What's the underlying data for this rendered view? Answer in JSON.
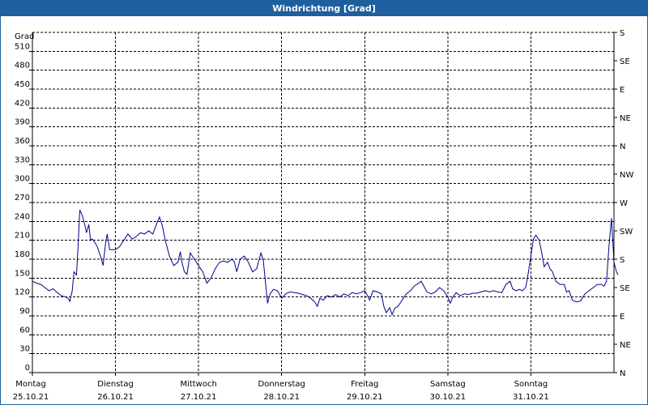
{
  "window": {
    "title": "Windrichtung [Grad]"
  },
  "chart_data": {
    "type": "line",
    "title": "Windrichtung [Grad]",
    "ylabel": "Grad",
    "ylim": [
      0,
      540
    ],
    "y_ticks": [
      0,
      30,
      60,
      90,
      120,
      150,
      180,
      210,
      240,
      270,
      300,
      330,
      360,
      390,
      420,
      450,
      480,
      510
    ],
    "y2_labels": [
      {
        "value": 0,
        "label": "N"
      },
      {
        "value": 30,
        "label": "NE"
      },
      {
        "value": 60,
        "label": "E"
      },
      {
        "value": 90,
        "label": "SE"
      },
      {
        "value": 120,
        "label": "S"
      },
      {
        "value": 150,
        "label": "SW"
      },
      {
        "value": 180,
        "label": "W"
      },
      {
        "value": 210,
        "label": "NW"
      },
      {
        "value": 240,
        "label": "N"
      },
      {
        "value": 270,
        "label": "NE"
      },
      {
        "value": 300,
        "label": "E"
      },
      {
        "value": 330,
        "label": "SE"
      },
      {
        "value": 360,
        "label": "S"
      }
    ],
    "xlim": [
      0,
      7
    ],
    "x_ticks": [
      {
        "day": "Montag",
        "date": "25.10.21",
        "x": 0
      },
      {
        "day": "Dienstag",
        "date": "26.10.21",
        "x": 1
      },
      {
        "day": "Mittwoch",
        "date": "27.10.21",
        "x": 2
      },
      {
        "day": "Donnerstag",
        "date": "28.10.21",
        "x": 3
      },
      {
        "day": "Freitag",
        "date": "29.10.21",
        "x": 4
      },
      {
        "day": "Samstag",
        "date": "30.10.21",
        "x": 5
      },
      {
        "day": "Sonntag",
        "date": "31.10.21",
        "x": 6
      }
    ],
    "grid": true,
    "series": [
      {
        "color": "#00008b",
        "points": [
          [
            0.0,
            145
          ],
          [
            0.05,
            142
          ],
          [
            0.1,
            140
          ],
          [
            0.15,
            135
          ],
          [
            0.2,
            130
          ],
          [
            0.25,
            133
          ],
          [
            0.3,
            127
          ],
          [
            0.35,
            122
          ],
          [
            0.4,
            120
          ],
          [
            0.43,
            118
          ],
          [
            0.45,
            113
          ],
          [
            0.48,
            130
          ],
          [
            0.5,
            160
          ],
          [
            0.53,
            155
          ],
          [
            0.55,
            200
          ],
          [
            0.57,
            258
          ],
          [
            0.6,
            250
          ],
          [
            0.63,
            235
          ],
          [
            0.65,
            222
          ],
          [
            0.68,
            235
          ],
          [
            0.7,
            210
          ],
          [
            0.72,
            212
          ],
          [
            0.75,
            207
          ],
          [
            0.78,
            200
          ],
          [
            0.82,
            185
          ],
          [
            0.85,
            170
          ],
          [
            0.88,
            205
          ],
          [
            0.9,
            220
          ],
          [
            0.93,
            195
          ],
          [
            1.0,
            195
          ],
          [
            1.05,
            200
          ],
          [
            1.1,
            210
          ],
          [
            1.15,
            220
          ],
          [
            1.2,
            212
          ],
          [
            1.25,
            216
          ],
          [
            1.3,
            222
          ],
          [
            1.35,
            220
          ],
          [
            1.4,
            225
          ],
          [
            1.45,
            220
          ],
          [
            1.5,
            238
          ],
          [
            1.53,
            247
          ],
          [
            1.56,
            235
          ],
          [
            1.6,
            210
          ],
          [
            1.65,
            185
          ],
          [
            1.7,
            170
          ],
          [
            1.75,
            175
          ],
          [
            1.78,
            192
          ],
          [
            1.8,
            175
          ],
          [
            1.83,
            160
          ],
          [
            1.86,
            156
          ],
          [
            1.9,
            190
          ],
          [
            1.95,
            180
          ],
          [
            2.0,
            170
          ],
          [
            2.05,
            160
          ],
          [
            2.1,
            142
          ],
          [
            2.15,
            150
          ],
          [
            2.2,
            165
          ],
          [
            2.25,
            175
          ],
          [
            2.3,
            177
          ],
          [
            2.35,
            175
          ],
          [
            2.4,
            180
          ],
          [
            2.43,
            176
          ],
          [
            2.46,
            160
          ],
          [
            2.5,
            180
          ],
          [
            2.55,
            185
          ],
          [
            2.6,
            175
          ],
          [
            2.65,
            160
          ],
          [
            2.7,
            165
          ],
          [
            2.75,
            190
          ],
          [
            2.78,
            178
          ],
          [
            2.8,
            150
          ],
          [
            2.83,
            110
          ],
          [
            2.86,
            125
          ],
          [
            2.9,
            132
          ],
          [
            2.95,
            130
          ],
          [
            3.0,
            118
          ],
          [
            3.05,
            125
          ],
          [
            3.1,
            128
          ],
          [
            3.2,
            126
          ],
          [
            3.3,
            122
          ],
          [
            3.35,
            118
          ],
          [
            3.4,
            112
          ],
          [
            3.43,
            105
          ],
          [
            3.46,
            118
          ],
          [
            3.5,
            115
          ],
          [
            3.55,
            122
          ],
          [
            3.6,
            120
          ],
          [
            3.65,
            124
          ],
          [
            3.7,
            120
          ],
          [
            3.75,
            125
          ],
          [
            3.8,
            122
          ],
          [
            3.85,
            127
          ],
          [
            3.9,
            125
          ],
          [
            3.95,
            127
          ],
          [
            4.0,
            130
          ],
          [
            4.03,
            123
          ],
          [
            4.06,
            115
          ],
          [
            4.1,
            130
          ],
          [
            4.15,
            128
          ],
          [
            4.2,
            125
          ],
          [
            4.23,
            105
          ],
          [
            4.26,
            95
          ],
          [
            4.3,
            103
          ],
          [
            4.33,
            92
          ],
          [
            4.36,
            102
          ],
          [
            4.4,
            105
          ],
          [
            4.45,
            115
          ],
          [
            4.5,
            125
          ],
          [
            4.55,
            130
          ],
          [
            4.6,
            138
          ],
          [
            4.65,
            142
          ],
          [
            4.68,
            145
          ],
          [
            4.72,
            135
          ],
          [
            4.75,
            128
          ],
          [
            4.8,
            125
          ],
          [
            4.85,
            128
          ],
          [
            4.9,
            135
          ],
          [
            4.95,
            130
          ],
          [
            5.0,
            120
          ],
          [
            5.03,
            110
          ],
          [
            5.06,
            120
          ],
          [
            5.1,
            127
          ],
          [
            5.15,
            122
          ],
          [
            5.2,
            125
          ],
          [
            5.25,
            124
          ],
          [
            5.3,
            126
          ],
          [
            5.35,
            126
          ],
          [
            5.4,
            128
          ],
          [
            5.45,
            130
          ],
          [
            5.5,
            128
          ],
          [
            5.55,
            130
          ],
          [
            5.6,
            128
          ],
          [
            5.65,
            127
          ],
          [
            5.7,
            140
          ],
          [
            5.75,
            145
          ],
          [
            5.78,
            133
          ],
          [
            5.82,
            130
          ],
          [
            5.86,
            132
          ],
          [
            5.9,
            130
          ],
          [
            5.94,
            136
          ],
          [
            5.97,
            160
          ],
          [
            6.0,
            185
          ],
          [
            6.03,
            212
          ],
          [
            6.06,
            218
          ],
          [
            6.1,
            210
          ],
          [
            6.13,
            190
          ],
          [
            6.16,
            168
          ],
          [
            6.2,
            175
          ],
          [
            6.23,
            165
          ],
          [
            6.26,
            160
          ],
          [
            6.3,
            145
          ],
          [
            6.35,
            140
          ],
          [
            6.4,
            140
          ],
          [
            6.43,
            128
          ],
          [
            6.46,
            130
          ],
          [
            6.5,
            115
          ],
          [
            6.55,
            112
          ],
          [
            6.6,
            114
          ],
          [
            6.65,
            125
          ],
          [
            6.7,
            130
          ],
          [
            6.75,
            135
          ],
          [
            6.8,
            140
          ],
          [
            6.85,
            140
          ],
          [
            6.88,
            137
          ],
          [
            6.91,
            145
          ],
          [
            6.94,
            200
          ],
          [
            6.97,
            245
          ],
          [
            7.0,
            175
          ],
          [
            7.03,
            160
          ],
          [
            7.05,
            155
          ]
        ]
      }
    ]
  }
}
